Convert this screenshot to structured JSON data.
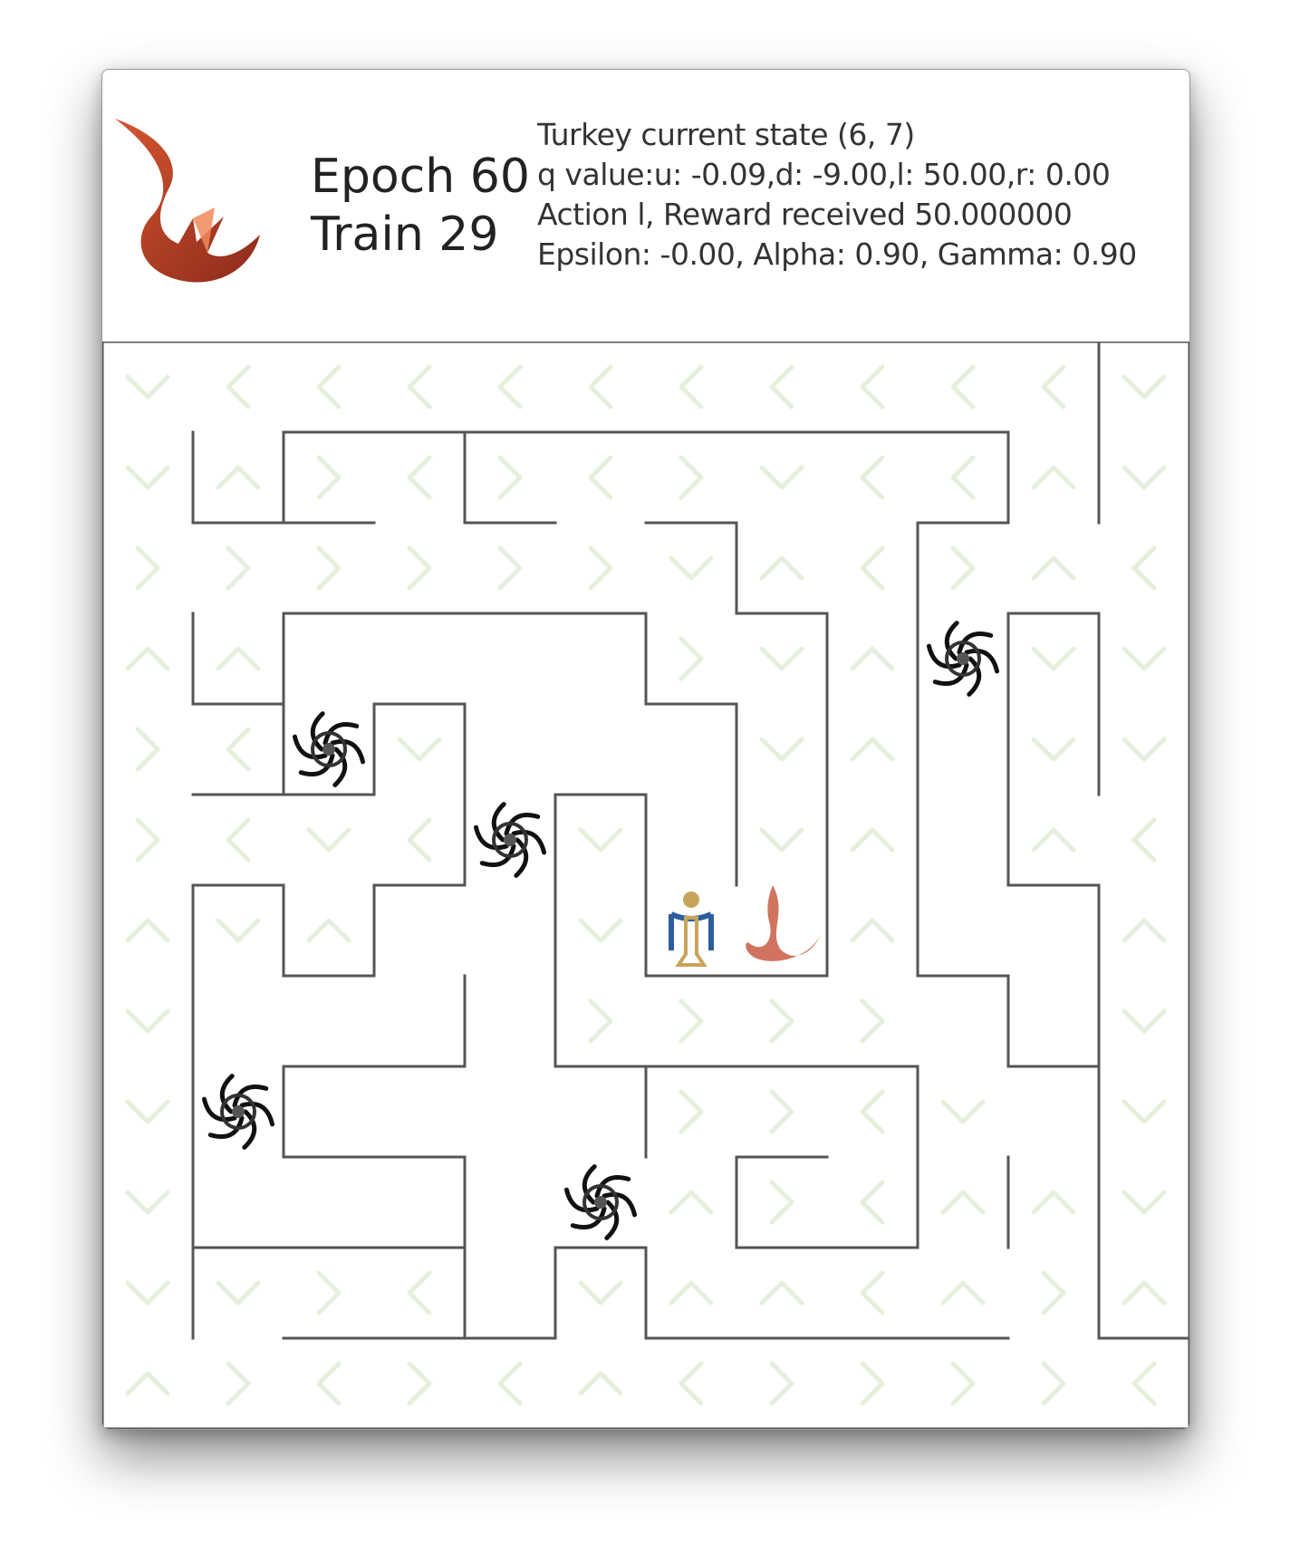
{
  "header": {
    "epoch_label": "Epoch 60",
    "train_label": "Train 29",
    "status_lines": [
      "Turkey current state (6, 7)",
      "q value:u: -0.09,d: -9.00,l: 50.00,r: 0.00",
      "Action l, Reward received 50.000000",
      "Epsilon: -0.00, Alpha: 0.90, Gamma: 0.90"
    ]
  },
  "maze": {
    "grid_size": 12,
    "colors": {
      "wall": "#555555",
      "arrow": "#e6efdc",
      "logo": "#c0452a",
      "agent_gold": "#c8a45a",
      "agent_blue": "#2e5d9e"
    },
    "policy_arrows": [
      [
        "down",
        "left",
        "left",
        "left",
        "left",
        "left",
        "left",
        "left",
        "left",
        "left",
        "left",
        "down"
      ],
      [
        "down",
        "up",
        "right",
        "left",
        "right",
        "left",
        "right",
        "down",
        "left",
        "left",
        "up",
        "down"
      ],
      [
        "right",
        "right",
        "right",
        "right",
        "right",
        "right",
        "down",
        "up",
        "left",
        "right",
        "up",
        "left"
      ],
      [
        "up",
        "up",
        "",
        "",
        "",
        "",
        "right",
        "down",
        "up",
        "",
        "down",
        "down"
      ],
      [
        "right",
        "left",
        "",
        "down",
        "",
        "",
        "",
        "down",
        "up",
        "",
        "down",
        "down"
      ],
      [
        "right",
        "left",
        "down",
        "left",
        "",
        "down",
        "",
        "down",
        "up",
        "",
        "up",
        "left"
      ],
      [
        "up",
        "down",
        "up",
        "",
        "",
        "down",
        "",
        "",
        "up",
        "",
        "",
        "up"
      ],
      [
        "down",
        "",
        "",
        "",
        "",
        "right",
        "right",
        "right",
        "right",
        "",
        "",
        "down"
      ],
      [
        "down",
        "",
        "",
        "",
        "",
        "",
        "right",
        "right",
        "left",
        "down",
        "",
        "down"
      ],
      [
        "down",
        "",
        "",
        "",
        "",
        "",
        "up",
        "right",
        "left",
        "up",
        "up",
        "down"
      ],
      [
        "down",
        "down",
        "right",
        "left",
        "",
        "down",
        "up",
        "up",
        "left",
        "up",
        "right",
        "up"
      ],
      [
        "up",
        "right",
        "left",
        "right",
        "left",
        "up",
        "left",
        "right",
        "right",
        "right",
        "right",
        "left"
      ]
    ],
    "traps": [
      {
        "row": 3,
        "col": 9
      },
      {
        "row": 4,
        "col": 2
      },
      {
        "row": 5,
        "col": 4
      },
      {
        "row": 8,
        "col": 1
      },
      {
        "row": 9,
        "col": 5
      }
    ],
    "agent": {
      "name": "turkey-agent-icon",
      "row": 6,
      "col": 6
    },
    "goal": {
      "name": "goal-logo-icon",
      "row": 6,
      "col": 7
    }
  }
}
